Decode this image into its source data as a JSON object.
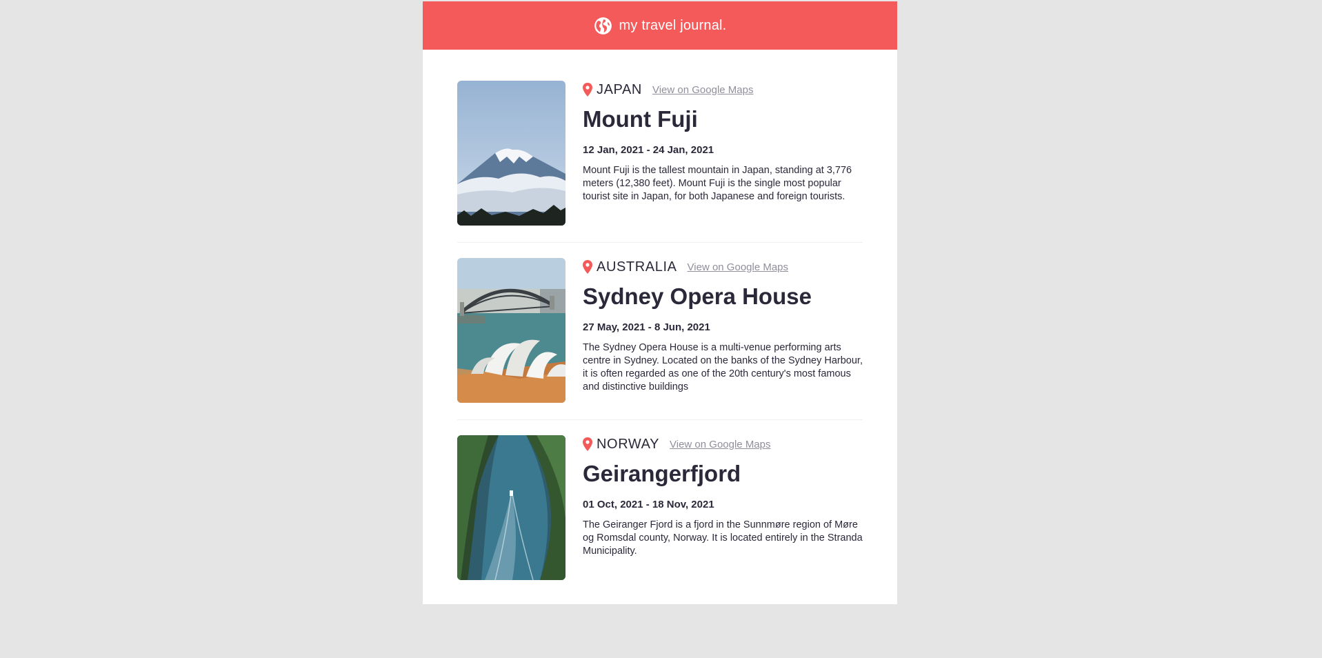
{
  "header": {
    "title": "my travel journal.",
    "icon": "globe-icon",
    "background": "#f55a5a"
  },
  "entries": [
    {
      "country": "JAPAN",
      "map_link": "View on Google Maps",
      "title": "Mount Fuji",
      "dates": "12 Jan, 2021 - 24 Jan, 2021",
      "description": "Mount Fuji is the tallest mountain in Japan, standing at 3,776 meters (12,380 feet). Mount Fuji is the single most popular tourist site in Japan, for both Japanese and foreign tourists.",
      "image": "mount-fuji-photo"
    },
    {
      "country": "AUSTRALIA",
      "map_link": "View on Google Maps",
      "title": "Sydney Opera House",
      "dates": "27 May, 2021 - 8 Jun, 2021",
      "description": "The Sydney Opera House is a multi-venue performing arts centre in Sydney. Located on the banks of the Sydney Harbour, it is often regarded as one of the 20th century's most famous and distinctive buildings",
      "image": "sydney-opera-house-photo"
    },
    {
      "country": "NORWAY",
      "map_link": "View on Google Maps",
      "title": "Geirangerfjord",
      "dates": "01 Oct, 2021 - 18 Nov, 2021",
      "description": "The Geiranger Fjord is a fjord in the Sunnmøre region of Møre og Romsdal county, Norway. It is located entirely in the Stranda Municipality.",
      "image": "geirangerfjord-photo"
    }
  ],
  "colors": {
    "accent": "#f55a5a",
    "text": "#2b283a",
    "link": "#918e9b",
    "background": "#e5e5e5"
  }
}
